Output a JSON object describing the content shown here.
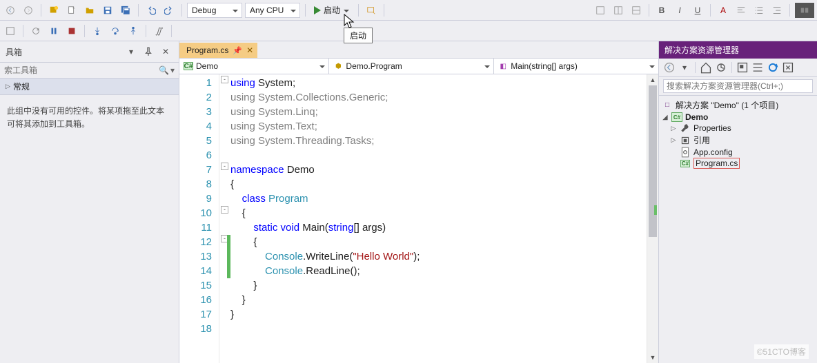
{
  "toolbar": {
    "config": "Debug",
    "platform": "Any CPU",
    "start_label": "启动",
    "tooltip": "启动"
  },
  "toolbox": {
    "title": "具箱",
    "search_placeholder": "索工具箱",
    "category": "常规",
    "empty": "此组中没有可用的控件。将某项拖至此文本可将其添加到工具箱。"
  },
  "editor": {
    "tab_name": "Program.cs",
    "nav1": "Demo",
    "nav2": "Demo.Program",
    "nav3": "Main(string[] args)",
    "lines": [
      {
        "n": 1,
        "html": "<span class='kw'>using</span> System;"
      },
      {
        "n": 2,
        "html": "<span class='kw faded'>using</span><span class='faded'> System.Collections.Generic;</span>"
      },
      {
        "n": 3,
        "html": "<span class='kw faded'>using</span><span class='faded'> System.Linq;</span>"
      },
      {
        "n": 4,
        "html": "<span class='kw faded'>using</span><span class='faded'> System.Text;</span>"
      },
      {
        "n": 5,
        "html": "<span class='kw faded'>using</span><span class='faded'> System.Threading.Tasks;</span>"
      },
      {
        "n": 6,
        "html": ""
      },
      {
        "n": 7,
        "html": "<span class='kw'>namespace</span> Demo"
      },
      {
        "n": 8,
        "html": "{"
      },
      {
        "n": 9,
        "html": "    <span class='kw'>class</span> <span class='cls'>Program</span>"
      },
      {
        "n": 10,
        "html": "    {"
      },
      {
        "n": 11,
        "html": "        <span class='kw'>static</span> <span class='kw'>void</span> Main(<span class='kw'>string</span>[] args)"
      },
      {
        "n": 12,
        "html": "        {"
      },
      {
        "n": 13,
        "html": "            <span class='typ'>Console</span>.WriteLine(<span class='str'>\"Hello World\"</span>);"
      },
      {
        "n": 14,
        "html": "            <span class='typ'>Console</span>.ReadLine();"
      },
      {
        "n": 15,
        "html": "        }"
      },
      {
        "n": 16,
        "html": "    }"
      },
      {
        "n": 17,
        "html": "}"
      },
      {
        "n": 18,
        "html": ""
      }
    ]
  },
  "solution": {
    "title": "解决方案资源管理器",
    "search_placeholder": "搜索解决方案资源管理器(Ctrl+;)",
    "root": "解决方案 \"Demo\" (1 个项目)",
    "project": "Demo",
    "items": [
      {
        "icon": "wrench",
        "label": "Properties"
      },
      {
        "icon": "ref",
        "label": "引用"
      },
      {
        "icon": "cfg",
        "label": "App.config"
      },
      {
        "icon": "cs",
        "label": "Program.cs",
        "hl": true
      }
    ]
  },
  "watermark": "©51CTO博客"
}
